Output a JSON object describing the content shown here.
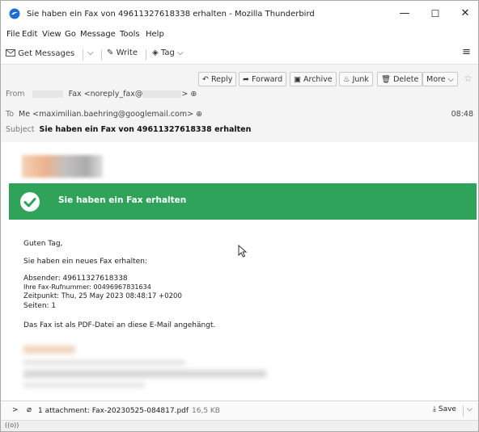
{
  "window": {
    "title": "Sie haben ein Fax von 49611327618338 erhalten - Mozilla Thunderbird",
    "minimize": "—",
    "maximize": "☐",
    "close": "✕"
  },
  "menu": [
    "File",
    "Edit",
    "View",
    "Go",
    "Message",
    "Tools",
    "Help"
  ],
  "toolbar": {
    "get_messages": "Get Messages",
    "write": "Write",
    "tag": "Tag",
    "hamburger": "≡"
  },
  "actions": {
    "reply": "Reply",
    "forward": "Forward",
    "archive": "Archive",
    "junk": "Junk",
    "delete": "Delete",
    "more": "More"
  },
  "headers": {
    "from_label": "From",
    "from_name": "Fax",
    "from_addr_start": "<noreply_fax@",
    "from_addr_end": ">",
    "to_label": "To",
    "to_value": "Me <maximilian.baehring@googlemail.com>",
    "time": "08:48",
    "subject_label": "Subject",
    "subject": "Sie haben ein Fax von 49611327618338 erhalten"
  },
  "message": {
    "banner": "Sie haben ein Fax erhalten",
    "greeting": "Guten Tag,",
    "intro": "Sie haben ein neues Fax erhalten:",
    "sender": "Absender: 49611327618338",
    "fax_number": "Ihre Fax-Rufnummer: 00496967831634",
    "timestamp": "Zeitpunkt: Thu, 25 May 2023 08:48:17 +0200",
    "pages": "Seiten: 1",
    "note": "Das Fax ist als PDF-Datei an diese E-Mail angehängt."
  },
  "attachment": {
    "label": "1 attachment: Fax-20230525-084817.pdf",
    "size": "16,5 KB",
    "save": "Save"
  },
  "status": {
    "icon": "((o))"
  },
  "colors": {
    "banner": "#2fa35a",
    "header_bg": "#f4f4f5"
  }
}
